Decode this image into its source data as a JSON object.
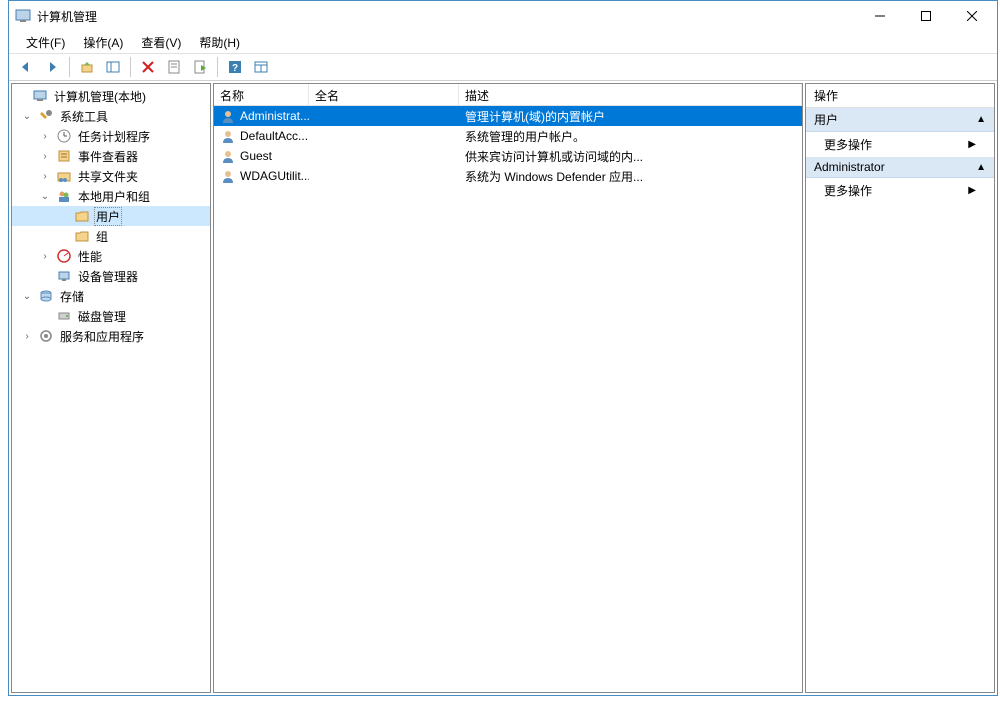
{
  "window": {
    "title": "计算机管理"
  },
  "menubar": {
    "file": "文件(F)",
    "action": "操作(A)",
    "view": "查看(V)",
    "help": "帮助(H)"
  },
  "tree": {
    "root": "计算机管理(本地)",
    "systemTools": "系统工具",
    "taskScheduler": "任务计划程序",
    "eventViewer": "事件查看器",
    "sharedFolders": "共享文件夹",
    "localUsersGroups": "本地用户和组",
    "users": "用户",
    "groups": "组",
    "performance": "性能",
    "deviceManager": "设备管理器",
    "storage": "存储",
    "diskManagement": "磁盘管理",
    "servicesApps": "服务和应用程序"
  },
  "list": {
    "headers": {
      "name": "名称",
      "fullName": "全名",
      "description": "描述"
    },
    "rows": [
      {
        "name": "Administrat...",
        "fullName": "",
        "description": "管理计算机(域)的内置帐户"
      },
      {
        "name": "DefaultAcc...",
        "fullName": "",
        "description": "系统管理的用户帐户。"
      },
      {
        "name": "Guest",
        "fullName": "",
        "description": "供来宾访问计算机或访问域的内..."
      },
      {
        "name": "WDAGUtilit...",
        "fullName": "",
        "description": "系统为 Windows Defender 应用..."
      }
    ]
  },
  "actions": {
    "header": "操作",
    "section1": "用户",
    "item1": "更多操作",
    "section2": "Administrator",
    "item2": "更多操作"
  }
}
